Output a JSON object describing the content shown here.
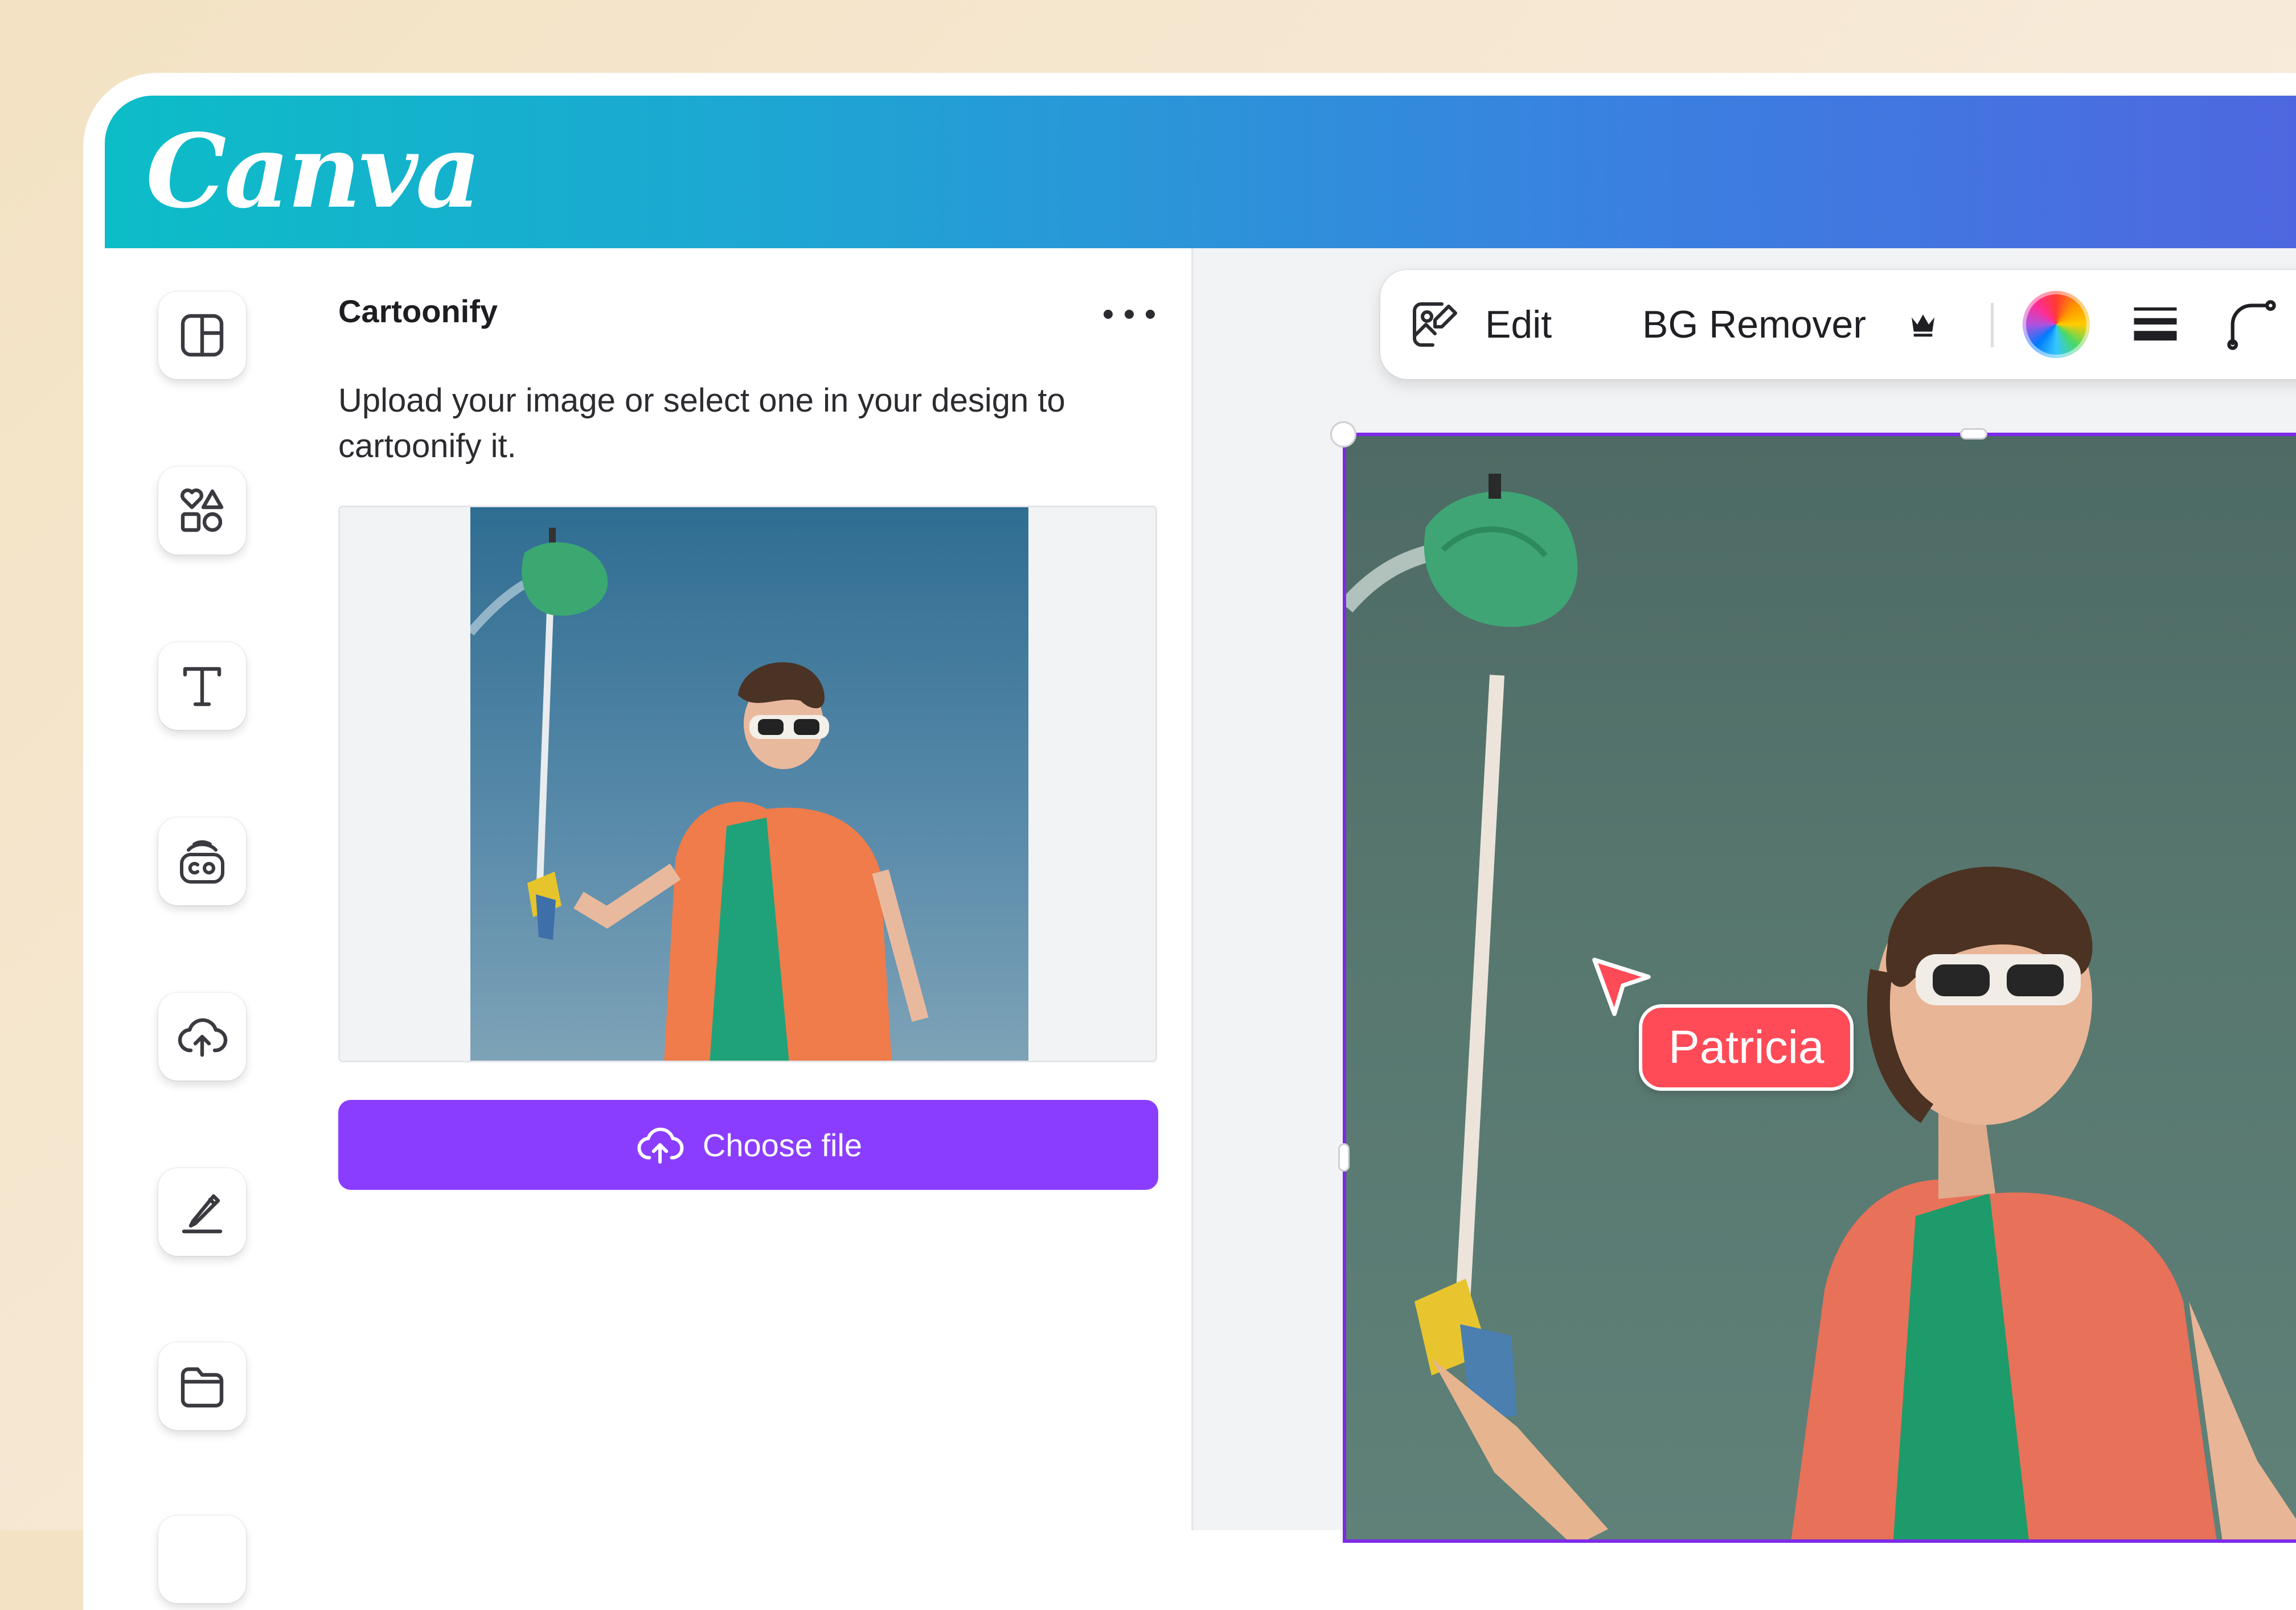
{
  "app": {
    "logo": "Canva"
  },
  "sidebar": {
    "items": [
      {
        "icon": "layout-icon",
        "label": "Design"
      },
      {
        "icon": "elements-icon",
        "label": "Elements"
      },
      {
        "icon": "text-icon",
        "label": "Text"
      },
      {
        "icon": "brand-icon",
        "label": "Brand"
      },
      {
        "icon": "uploads-icon",
        "label": "Uploads"
      },
      {
        "icon": "draw-icon",
        "label": "Draw"
      },
      {
        "icon": "projects-icon",
        "label": "Projects"
      }
    ]
  },
  "panel": {
    "title": "Cartoonify",
    "description": "Upload your image or select one in your design to cartoonify it.",
    "more_icon": "more-horizontal-icon",
    "choose_button": "Choose file",
    "choose_icon": "cloud-upload-icon"
  },
  "toolbar": {
    "edit_label": "Edit",
    "edit_icon": "image-edit-icon",
    "bg_remover_label": "BG Remover",
    "premium_icon": "crown-icon",
    "color_icon": "color-wheel-icon",
    "lines_icon": "line-weight-icon",
    "corner_icon": "corner-rounding-icon"
  },
  "canvas": {
    "collaborator_name": "Patricia",
    "collaborator_color": "#ff4b57",
    "selection_color": "#7d2ae8"
  },
  "colors": {
    "accent": "#8b3dff",
    "header_gradient_start": "#0cbdc7",
    "header_gradient_end": "#4f66e0"
  }
}
